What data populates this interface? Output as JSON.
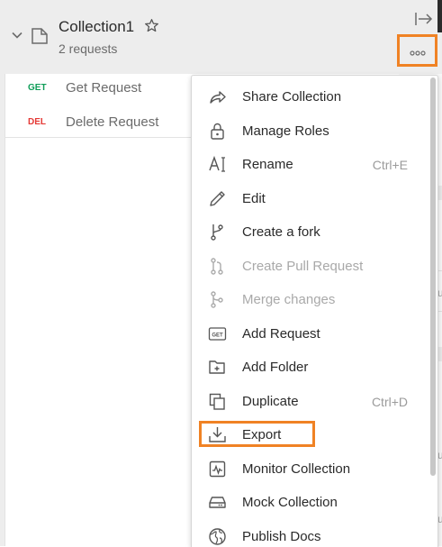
{
  "collection": {
    "name": "Collection1",
    "subtitle": "2 requests",
    "requests": [
      {
        "method": "GET",
        "name": "Get Request",
        "color": "#0f9d58"
      },
      {
        "method": "DEL",
        "name": "Delete Request",
        "color": "#e53935"
      }
    ]
  },
  "menu": {
    "items": [
      {
        "label": "Share Collection",
        "icon": "share-icon",
        "shortcut": "",
        "disabled": false
      },
      {
        "label": "Manage Roles",
        "icon": "lock-icon",
        "shortcut": "",
        "disabled": false
      },
      {
        "label": "Rename",
        "icon": "rename-icon",
        "shortcut": "Ctrl+E",
        "disabled": false
      },
      {
        "label": "Edit",
        "icon": "pencil-icon",
        "shortcut": "",
        "disabled": false
      },
      {
        "label": "Create a fork",
        "icon": "fork-icon",
        "shortcut": "",
        "disabled": false
      },
      {
        "label": "Create Pull Request",
        "icon": "pull-request-icon",
        "shortcut": "",
        "disabled": true
      },
      {
        "label": "Merge changes",
        "icon": "merge-icon",
        "shortcut": "",
        "disabled": true
      },
      {
        "label": "Add Request",
        "icon": "get-request-icon",
        "shortcut": "",
        "disabled": false
      },
      {
        "label": "Add Folder",
        "icon": "add-folder-icon",
        "shortcut": "",
        "disabled": false
      },
      {
        "label": "Duplicate",
        "icon": "duplicate-icon",
        "shortcut": "Ctrl+D",
        "disabled": false
      },
      {
        "label": "Export",
        "icon": "export-icon",
        "shortcut": "",
        "disabled": false
      },
      {
        "label": "Monitor Collection",
        "icon": "monitor-icon",
        "shortcut": "",
        "disabled": false
      },
      {
        "label": "Mock Collection",
        "icon": "mock-server-icon",
        "shortcut": "",
        "disabled": false
      },
      {
        "label": "Publish Docs",
        "icon": "globe-icon",
        "shortcut": "",
        "disabled": false
      }
    ],
    "get_badge_text": "GET"
  },
  "side_peek": {
    "u1": "u",
    "u2": "u",
    "u3": "u"
  },
  "colors": {
    "highlight": "#f08224",
    "header_bg": "#ededed"
  }
}
